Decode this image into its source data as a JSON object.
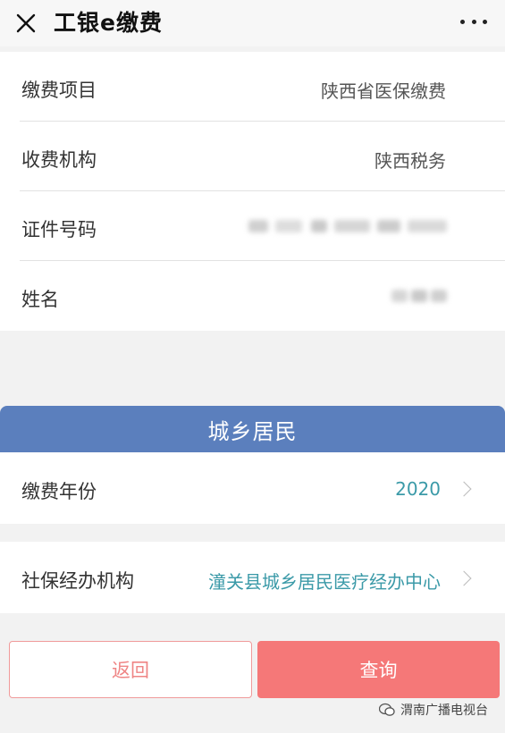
{
  "header": {
    "title": "工银e缴费"
  },
  "info_rows": [
    {
      "label": "缴费项目",
      "value": "陕西省医保缴费"
    },
    {
      "label": "收费机构",
      "value": "陕西税务"
    },
    {
      "label": "证件号码",
      "value": ""
    },
    {
      "label": "姓名",
      "value": ""
    }
  ],
  "banner": {
    "text": "城乡居民"
  },
  "select_rows": [
    {
      "label": "缴费年份",
      "value": "2020"
    },
    {
      "label": "社保经办机构",
      "value": "潼关县城乡居民医疗经办中心"
    }
  ],
  "actions": {
    "back_label": "返回",
    "query_label": "查询"
  },
  "watermark": {
    "text": "渭南广播电视台"
  },
  "colors": {
    "banner": "#5b7fbd",
    "accent_link": "#3b9aa8",
    "primary_button": "#f57878",
    "secondary_button_border": "#f09a9a"
  }
}
